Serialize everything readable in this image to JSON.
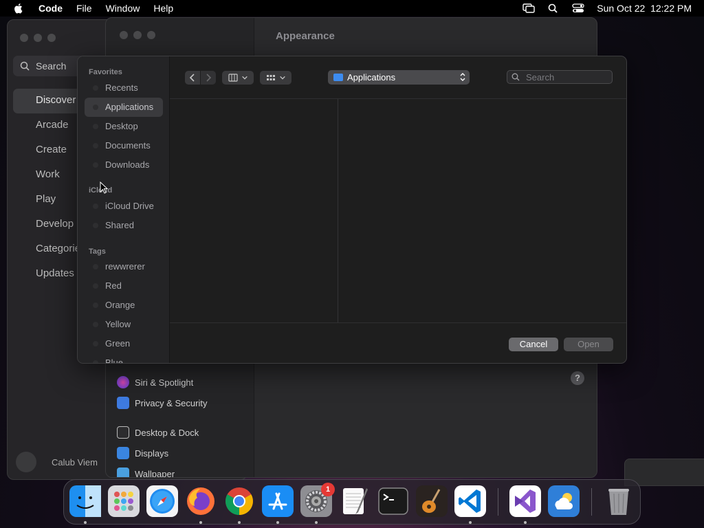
{
  "menubar": {
    "app_name": "Code",
    "items": [
      "File",
      "Window",
      "Help"
    ],
    "datetime": "Sun Oct 22  12:22 PM"
  },
  "appstore": {
    "search_label": "Search",
    "nav": [
      "Discover",
      "Arcade",
      "Create",
      "Work",
      "Play",
      "Develop",
      "Categories",
      "Updates"
    ],
    "active_index": 0,
    "user_name": "Calub Viem"
  },
  "settings": {
    "title": "Appearance",
    "sidebar": [
      "Siri & Spotlight",
      "Privacy & Security",
      "Desktop & Dock",
      "Displays",
      "Wallpaper"
    ],
    "help": "?"
  },
  "dialog": {
    "sections": {
      "favorites": "Favorites",
      "icloud": "iCloud",
      "tags": "Tags"
    },
    "favorites": [
      "Recents",
      "Applications",
      "Desktop",
      "Documents",
      "Downloads"
    ],
    "selected_favorite": "Applications",
    "icloud": [
      "iCloud Drive",
      "Shared"
    ],
    "tags": [
      "rewwrerer",
      "Red",
      "Orange",
      "Yellow",
      "Green",
      "Blue"
    ],
    "location": "Applications",
    "search_placeholder": "Search",
    "cancel_label": "Cancel",
    "open_label": "Open"
  },
  "dock": {
    "apps": [
      "Finder",
      "Launchpad",
      "Safari",
      "Firefox",
      "Chrome",
      "App Store",
      "System Settings",
      "TextEdit",
      "Terminal",
      "GarageBand",
      "VS Code",
      "Visual Studio",
      "Weather",
      "Trash"
    ],
    "settings_badge": "1"
  }
}
